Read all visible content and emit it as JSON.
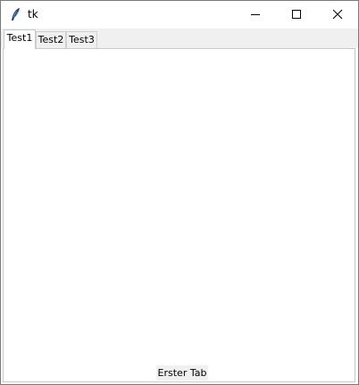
{
  "window": {
    "title": "tk",
    "app_icon": "tk-feather-icon",
    "controls": {
      "minimize_icon": "minimize-icon",
      "maximize_icon": "maximize-icon",
      "close_icon": "close-icon"
    }
  },
  "tabs": [
    {
      "label": "Test1",
      "active": true
    },
    {
      "label": "Test2",
      "active": false
    },
    {
      "label": "Test3",
      "active": false
    }
  ],
  "panel": {
    "label": "Erster Tab"
  },
  "colors": {
    "tabbar_bg": "#f0f0f0",
    "panel_bg": "#ffffff",
    "border": "#c8c8c8"
  }
}
